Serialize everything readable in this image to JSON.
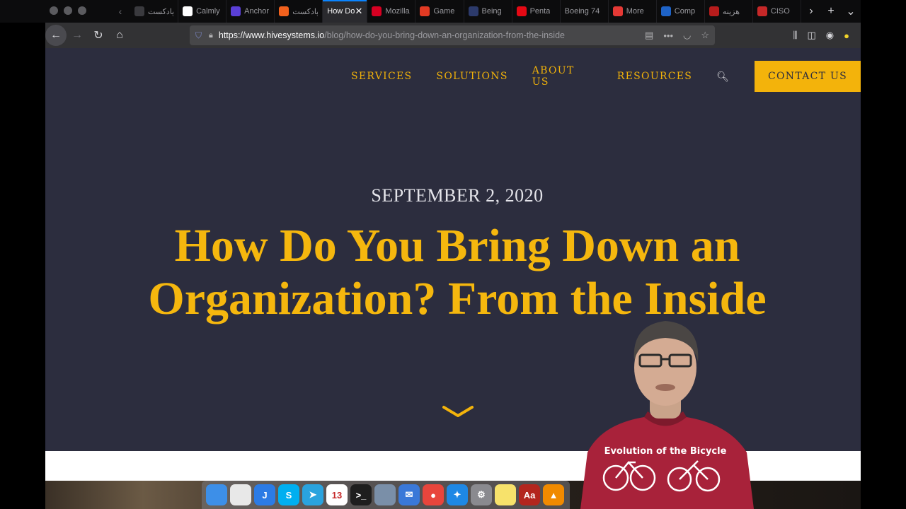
{
  "browser": {
    "tabs": [
      {
        "label": "پادکست",
        "icon": "podcast-icon",
        "color": "#3a3a3e"
      },
      {
        "label": "Calmly",
        "icon": "lotus-icon",
        "color": "#ffffff"
      },
      {
        "label": "Anchor",
        "icon": "anchor-app-icon",
        "color": "#5a3fd6"
      },
      {
        "label": "پادکست",
        "icon": "castbox-icon",
        "color": "#f2611d"
      },
      {
        "label": "How Do",
        "icon": "",
        "color": "",
        "active": true
      },
      {
        "label": "Mozilla",
        "icon": "pocket-icon",
        "color": "#d70022"
      },
      {
        "label": "Game",
        "icon": "game-icon",
        "color": "#e23a23"
      },
      {
        "label": "Being",
        "icon": "being-icon",
        "color": "#2c3a6b"
      },
      {
        "label": "Penta",
        "icon": "netflix-icon",
        "color": "#e50914"
      },
      {
        "label": "Boeing 74",
        "icon": "",
        "color": ""
      },
      {
        "label": "More",
        "icon": "more-site-icon",
        "color": "#e53935"
      },
      {
        "label": "Comp",
        "icon": "s-site-icon",
        "color": "#1e63c7"
      },
      {
        "label": "هزینه",
        "icon": "red-site-icon",
        "color": "#b71c1c"
      },
      {
        "label": "CISO",
        "icon": "ciso-icon",
        "color": "#c62828"
      }
    ],
    "url_host": "https://www.hivesystems.io",
    "url_path": "/blog/how-do-you-bring-down-an-organization-from-the-inside"
  },
  "site": {
    "nav": [
      "SERVICES",
      "SOLUTIONS",
      "ABOUT US",
      "RESOURCES"
    ],
    "contact_label": "CONTACT US",
    "accent": "#f3b30b",
    "background": "#2c2d3e"
  },
  "post": {
    "date": "SEPTEMBER 2, 2020",
    "title_line1": "How Do You Bring Down an",
    "title_line2": "Organization? From the Inside"
  },
  "dock": {
    "apps": [
      {
        "name": "finder-icon",
        "color": "#3d8fe8",
        "glyph": ""
      },
      {
        "name": "textedit-icon",
        "color": "#e8e8e8",
        "glyph": ""
      },
      {
        "name": "jetbrains-icon",
        "color": "#2c7be5",
        "glyph": "J"
      },
      {
        "name": "skype-icon",
        "color": "#00aff0",
        "glyph": "S"
      },
      {
        "name": "telegram-icon",
        "color": "#2aa3de",
        "glyph": "➤"
      },
      {
        "name": "calendar-icon",
        "color": "#ffffff",
        "glyph": "13"
      },
      {
        "name": "terminal-icon",
        "color": "#1e1e1e",
        "glyph": ">_"
      },
      {
        "name": "preview-icon",
        "color": "#7a8fa8",
        "glyph": ""
      },
      {
        "name": "mail-icon",
        "color": "#3a78d8",
        "glyph": "✉"
      },
      {
        "name": "chrome-icon",
        "color": "#e8453c",
        "glyph": "●"
      },
      {
        "name": "safari-icon",
        "color": "#1e88e5",
        "glyph": "✦"
      },
      {
        "name": "system-preferences-icon",
        "color": "#8a8a8f",
        "glyph": "⚙"
      },
      {
        "name": "stickies-icon",
        "color": "#f7e26b",
        "glyph": ""
      },
      {
        "name": "dictionary-icon",
        "color": "#b3261e",
        "glyph": "Aa"
      },
      {
        "name": "vlc-icon",
        "color": "#f08a00",
        "glyph": "▲"
      }
    ]
  }
}
